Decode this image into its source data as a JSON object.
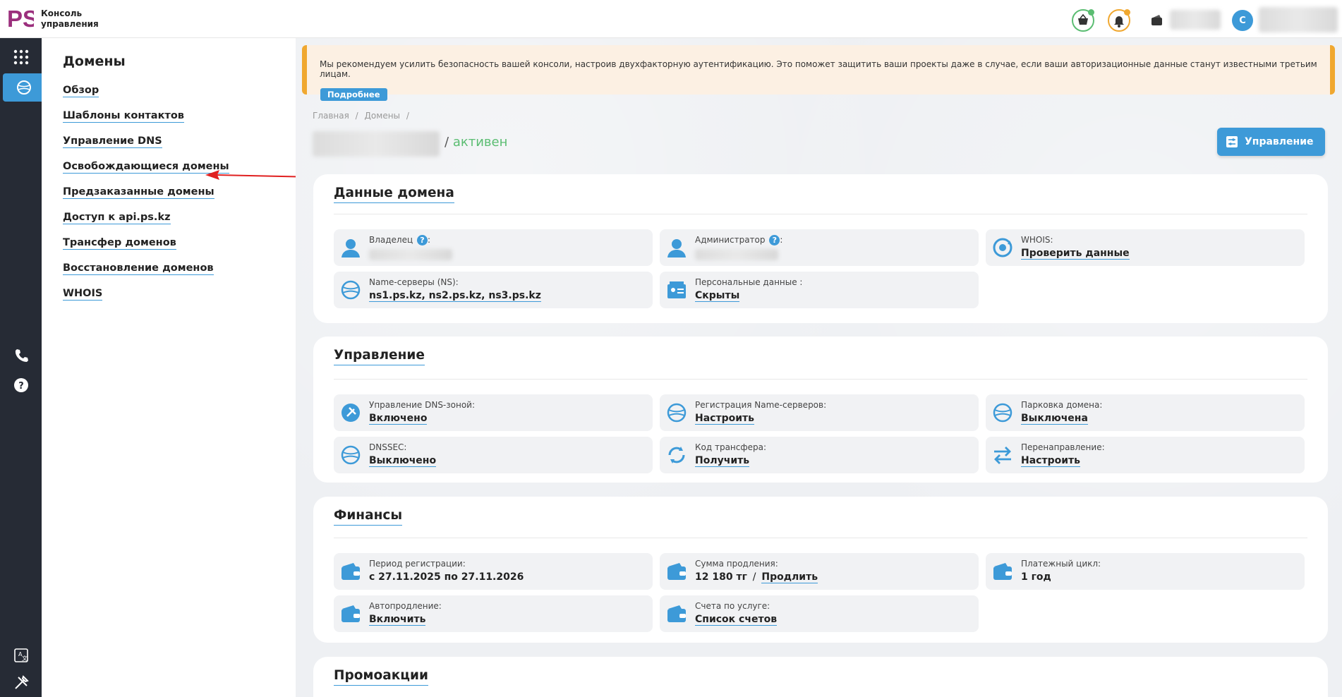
{
  "header": {
    "logo_text": "PS",
    "app_title_line1": "Консоль",
    "app_title_line2": "управления",
    "user_initial": "С"
  },
  "colors": {
    "accent": "#3d9ad8",
    "rail": "#262b35",
    "warning": "#f0a830",
    "success": "#5bbd72",
    "brand": "#9b2f7d"
  },
  "sidebar": {
    "title": "Домены",
    "items": [
      {
        "label": "Обзор"
      },
      {
        "label": "Шаблоны контактов"
      },
      {
        "label": "Управление DNS"
      },
      {
        "label": "Освобождающиеся домены"
      },
      {
        "label": "Предзаказанные домены"
      },
      {
        "label": "Доступ к api.ps.kz"
      },
      {
        "label": "Трансфер доменов"
      },
      {
        "label": "Восстановление доменов"
      },
      {
        "label": "WHOIS"
      }
    ]
  },
  "alert": {
    "text": "Мы рекомендуем усилить безопасность вашей консоли, настроив двухфакторную аутентификацию. Это поможет защитить ваши проекты даже в случае, если ваши авторизационные данные станут известными третьим лицам.",
    "more_label": "Подробнее"
  },
  "breadcrumb": {
    "home": "Главная",
    "sep": "/",
    "domains": "Домены"
  },
  "domain": {
    "status_prefix": "/",
    "status": "активен"
  },
  "manage_button": "Управление",
  "domain_data": {
    "title": "Данные домена",
    "owner_label": "Владелец",
    "admin_label": "Администратор",
    "help_mark": "?",
    "colon": ":",
    "whois_label": "WHOIS:",
    "whois_value": "Проверить данные",
    "ns_label": "Name-серверы (NS):",
    "ns_value": "ns1.ps.kz, ns2.ps.kz, ns3.ps.kz",
    "personal_label": "Персональные данные :",
    "personal_value": "Скрыты"
  },
  "management": {
    "title": "Управление",
    "dns_zone_label": "Управление DNS-зоной:",
    "dns_zone_value": "Включено",
    "ns_reg_label": "Регистрация Name-серверов:",
    "ns_reg_value": "Настроить",
    "parking_label": "Парковка домена:",
    "parking_value": "Выключена",
    "dnssec_label": "DNSSEC:",
    "dnssec_value": "Выключено",
    "transfer_label": "Код трансфера:",
    "transfer_value": "Получить",
    "redirect_label": "Перенаправление:",
    "redirect_value": "Настроить"
  },
  "finance": {
    "title": "Финансы",
    "period_label": "Период регистрации:",
    "period_value": "с 27.11.2025 по 27.11.2026",
    "renew_sum_label": "Сумма продления:",
    "renew_sum_value": "12 180 тг",
    "renew_sep": "/",
    "renew_action": "Продлить",
    "cycle_label": "Платежный цикл:",
    "cycle_value": "1 год",
    "autorenew_label": "Автопродление:",
    "autorenew_value": "Включить",
    "invoices_label": "Счета по услуге:",
    "invoices_value": "Список счетов"
  },
  "promo": {
    "title": "Промоакции"
  }
}
